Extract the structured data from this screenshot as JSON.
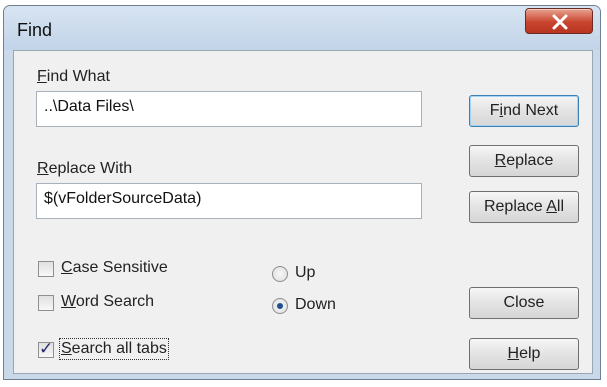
{
  "window": {
    "title": "Find",
    "close_icon": "close-x-icon"
  },
  "find_what": {
    "label_key": "F",
    "label_rest": "ind What",
    "value": "..\\Data Files\\"
  },
  "replace_with": {
    "label_key": "R",
    "label_rest": "eplace With",
    "value": "$(vFolderSourceData)"
  },
  "options": {
    "case_sensitive": {
      "key": "C",
      "rest": "ase Sensitive",
      "checked": false
    },
    "word_search": {
      "key": "W",
      "rest": "ord Search",
      "checked": false
    },
    "search_all_tabs": {
      "key": "S",
      "rest": "earch all tabs",
      "checked": true
    }
  },
  "direction": {
    "up": "Up",
    "down": "Down",
    "selected": "Down"
  },
  "buttons": {
    "find_next": {
      "pre": "F",
      "key": "i",
      "post": "nd Next"
    },
    "replace": {
      "pre": "",
      "key": "R",
      "post": "eplace"
    },
    "replace_all": {
      "pre": "Replace ",
      "key": "A",
      "post": "ll"
    },
    "close": {
      "pre": "Close",
      "key": "",
      "post": ""
    },
    "help": {
      "pre": "",
      "key": "H",
      "post": "elp"
    }
  },
  "colors": {
    "accent": "#1f4e8c",
    "close_button": "#c9452f",
    "title_bar": "#c9d9ea"
  }
}
